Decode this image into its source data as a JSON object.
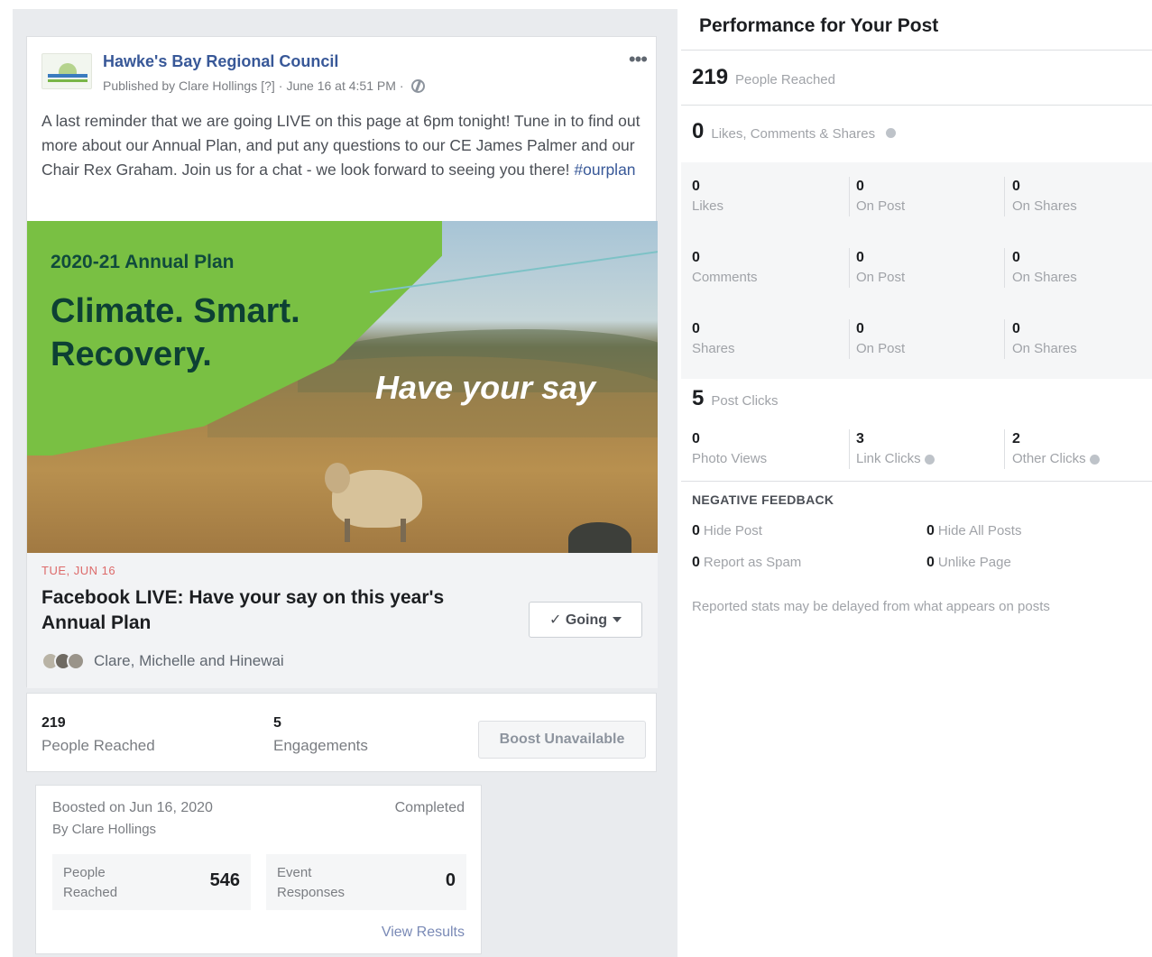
{
  "post": {
    "page_name": "Hawke's Bay Regional Council",
    "published_by": "Published by Clare Hollings",
    "published_qmark": "[?]",
    "published_sep": "·",
    "published_date": "June 16 at 4:51 PM",
    "published_sep2": "·",
    "more": "•••",
    "text": "A last reminder that we are going LIVE on this page at 6pm tonight! Tune in to find out more about our Annual Plan, and put any questions to our CE James Palmer and our Chair Rex Graham. Join us for a chat - we look forward to seeing you there! ",
    "hashtag": "#ourplan",
    "image": {
      "kicker": "2020-21 Annual Plan",
      "title_line1": "Climate. Smart.",
      "title_line2": "Recovery.",
      "tagline": "Have your say"
    },
    "event": {
      "date": "TUE, JUN 16",
      "title": "Facebook LIVE: Have your say on this year's Annual Plan",
      "going_label": "✓ Going",
      "people": "Clare, Michelle and Hinewai"
    }
  },
  "stats": {
    "reached_num": "219",
    "reached_label": "People Reached",
    "engagements_num": "5",
    "engagements_label": "Engagements",
    "boost_label": "Boost Unavailable"
  },
  "boost": {
    "boosted_on": "Boosted on Jun 16, 2020",
    "by": "By Clare Hollings",
    "status": "Completed",
    "reached_label_1": "People",
    "reached_label_2": "Reached",
    "reached_value": "546",
    "responses_label_1": "Event",
    "responses_label_2": "Responses",
    "responses_value": "0",
    "view_results": "View Results"
  },
  "performance": {
    "title": "Performance for Your Post",
    "people_reached_num": "219",
    "people_reached_label": "People Reached",
    "lcs_num": "0",
    "lcs_label": "Likes, Comments & Shares",
    "rows": [
      {
        "a_num": "0",
        "a_lbl": "Likes",
        "b_num": "0",
        "b_lbl": "On Post",
        "c_num": "0",
        "c_lbl": "On Shares"
      },
      {
        "a_num": "0",
        "a_lbl": "Comments",
        "b_num": "0",
        "b_lbl": "On Post",
        "c_num": "0",
        "c_lbl": "On Shares"
      },
      {
        "a_num": "0",
        "a_lbl": "Shares",
        "b_num": "0",
        "b_lbl": "On Post",
        "c_num": "0",
        "c_lbl": "On Shares"
      }
    ],
    "post_clicks_num": "5",
    "post_clicks_label": "Post Clicks",
    "clicks": {
      "a_num": "0",
      "a_lbl": "Photo Views",
      "b_num": "3",
      "b_lbl": "Link Clicks",
      "c_num": "2",
      "c_lbl": "Other Clicks"
    },
    "negative_header": "NEGATIVE FEEDBACK",
    "negative": [
      {
        "num": "0",
        "label": "Hide Post"
      },
      {
        "num": "0",
        "label": "Hide All Posts"
      },
      {
        "num": "0",
        "label": "Report as Spam"
      },
      {
        "num": "0",
        "label": "Unlike Page"
      }
    ],
    "footnote": "Reported stats may be delayed from what appears on posts"
  },
  "colors": {
    "link": "#385898",
    "event_date": "#dd6a6a",
    "image_green": "#79c043",
    "image_title": "#0d4034"
  }
}
